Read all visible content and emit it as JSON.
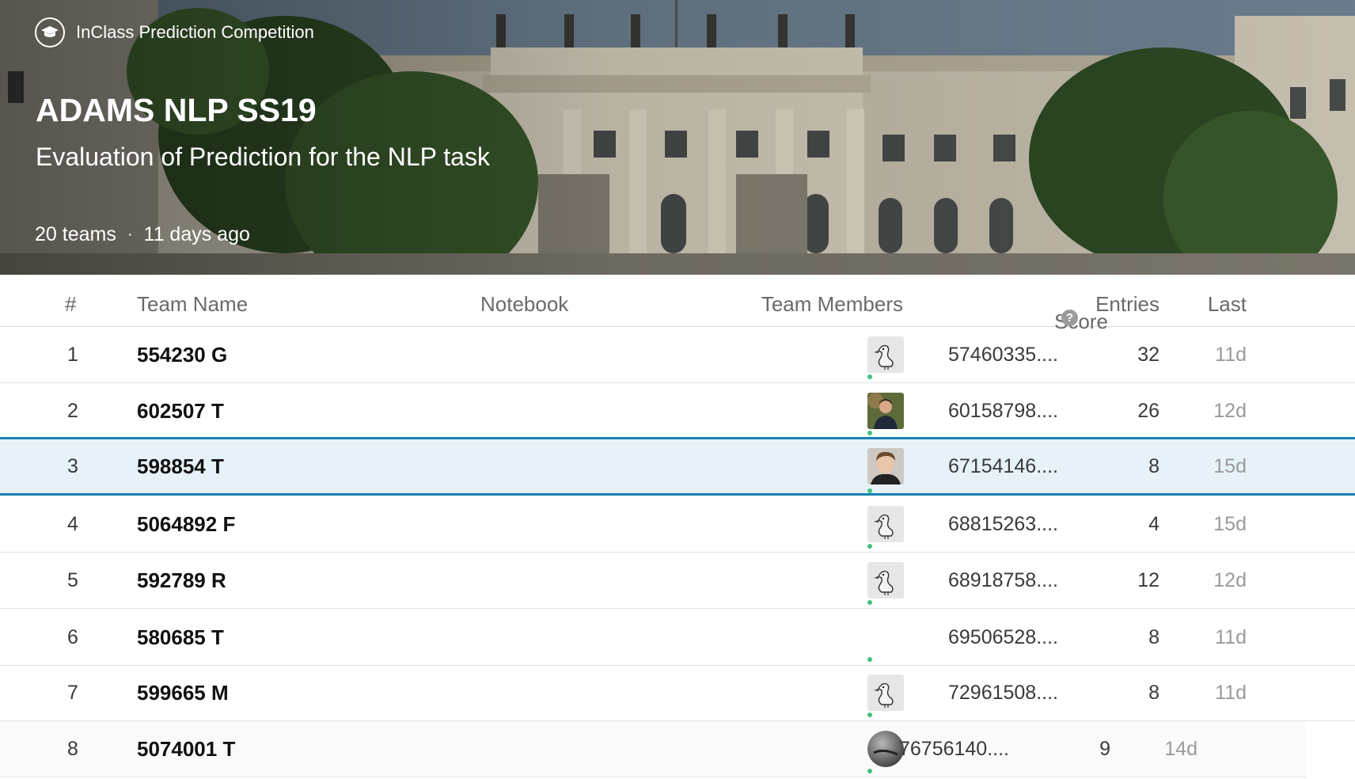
{
  "banner": {
    "competition_type": "InClass Prediction Competition",
    "title": "ADAMS NLP SS19",
    "subtitle": "Evaluation of Prediction for the NLP task",
    "teams": "20 teams",
    "separator": "·",
    "age": "11 days ago"
  },
  "table": {
    "headers": {
      "rank": "#",
      "team": "Team Name",
      "notebook": "Notebook",
      "members": "Team Members",
      "score": "Score",
      "score_help": "?",
      "entries": "Entries",
      "last": "Last"
    },
    "rows": [
      {
        "rank": "1",
        "team": "554230 G",
        "avatar": "goose",
        "score": "57460335....",
        "entries": "32",
        "last": "11d"
      },
      {
        "rank": "2",
        "team": "602507 T",
        "avatar": "photo-green",
        "score": "60158798....",
        "entries": "26",
        "last": "12d"
      },
      {
        "rank": "3",
        "team": "598854 T",
        "avatar": "photo-face",
        "score": "67154146....",
        "entries": "8",
        "last": "15d"
      },
      {
        "rank": "4",
        "team": "5064892 F",
        "avatar": "goose",
        "score": "68815263....",
        "entries": "4",
        "last": "15d"
      },
      {
        "rank": "5",
        "team": "592789 R",
        "avatar": "goose",
        "score": "68918758....",
        "entries": "12",
        "last": "12d"
      },
      {
        "rank": "6",
        "team": "580685 T",
        "avatar": "none",
        "score": "69506528....",
        "entries": "8",
        "last": "11d"
      },
      {
        "rank": "7",
        "team": "599665 M",
        "avatar": "goose",
        "score": "72961508....",
        "entries": "8",
        "last": "11d"
      },
      {
        "rank": "8",
        "team": "5074001 T",
        "avatar": "photo-grey",
        "score": "76756140....",
        "entries": "9",
        "last": "14d"
      }
    ]
  },
  "colors": {
    "highlight_border": "#1a7fb5",
    "highlight_bg": "#e6f1f8",
    "online_dot": "#3cc47c"
  },
  "icons": {
    "competition_badge": "graduation-cap-icon",
    "score_help": "question-circle-icon"
  }
}
